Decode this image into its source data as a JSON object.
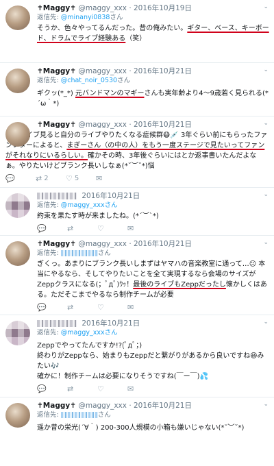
{
  "tweets": [
    {
      "name": "✝Maggy✝",
      "handle": "@maggy_xxx",
      "date": "2016年10月19日",
      "reply_prefix": "返信先:",
      "reply_to": "@minanyi0838",
      "reply_suffix": "さん",
      "body_parts": [
        "そうか、色々やってるんだった。昔の俺みたい。",
        "ギター、ベース、キーボード、ドラムでライブ経験ある",
        "（笑）"
      ],
      "show_actions": false
    },
    {
      "name": "✝Maggy✝",
      "handle": "@maggy_xxx",
      "date": "2016年10月21日",
      "reply_prefix": "返信先:",
      "reply_to": "@chat_noir_0530",
      "reply_suffix": "さん",
      "body_parts": [
        "ギクッ(*_*) ",
        "元バンドマンのマギー",
        "さんも実年齢より4～9歳若く見られる(*´ω｀*)"
      ],
      "show_actions": false
    },
    {
      "name": "✝Maggy✝",
      "handle": "@maggy_xxx",
      "date": "2016年10月21日",
      "body_parts": [
        "人のライブ見ると自分のライブやりたくなる症候群😷💉 3年ぐらい前にもらったファンレターによると、",
        "まぎーさん（の中の人）をもう一度ステージで見たいってファンがそれなりにいるらしい。",
        "確かその時、3年後ぐらいにはとか返事書いたんだよなぁ。やりたいけどブランク長いしなぁ(*˘︶˘*)悩"
      ],
      "actions": {
        "reply_count": "",
        "retweet_count": "2",
        "like_count": "5"
      },
      "show_actions": true
    },
    {
      "name_blurred": true,
      "date": "2016年10月21日",
      "reply_prefix": "返信先:",
      "reply_to": "@maggy_xxxさん",
      "body_parts": [
        "約束を果たす時が来ましたね。(*´︶`*)"
      ],
      "show_actions": true
    },
    {
      "name": "✝Maggy✝",
      "handle": "@maggy_xxx",
      "date": "2016年10月21日",
      "reply_prefix": "返信先:",
      "reply_suffix": "さん",
      "reply_to_blurred": true,
      "body_parts": [
        "ぎくっ。あまりにブランク長いしまずはヤマハの音楽教室に通って…😕 本当にやるなら、そしてやりたいことを全て実現するなら会場のサイズがZeppクラスになる(；ﾟдﾟ)ｳｯ！",
        "最後のライブもZeppだったし",
        "懐かしくはある。ただそこまでやるなら制作チームが必要"
      ],
      "show_actions": true
    },
    {
      "name_blurred": true,
      "date": "2016年10月21日",
      "reply_prefix": "返信先:",
      "reply_to": "@maggy_xxxさん",
      "body_parts": [
        "Zeppでやってたんですか!?(ﾟдﾟ；)",
        "終わりがZeppなら、始まりもZeppだと繋がりがあるから良いですね😆みたい🎶",
        "確かに！制作チームは必要になりそうですね(￣ー￣)💦"
      ],
      "show_actions": true
    },
    {
      "name": "✝Maggy✝",
      "handle": "@maggy_xxx",
      "date": "2016年10月21日",
      "reply_prefix": "返信先:",
      "reply_suffix": "さん",
      "reply_to_blurred": true,
      "body_parts": [
        "遥か昔の栄光(´∀｀) 200-300人規模の小箱も嫌いじゃない(*˘︶˘*)"
      ],
      "show_actions": false
    }
  ],
  "icons": {
    "chevron": "chevron-down-icon",
    "reply": "reply-icon",
    "retweet": "retweet-icon",
    "like": "heart-icon",
    "dm": "envelope-icon"
  },
  "underline_color": "#d0021b",
  "link_color": "#1da1f2"
}
